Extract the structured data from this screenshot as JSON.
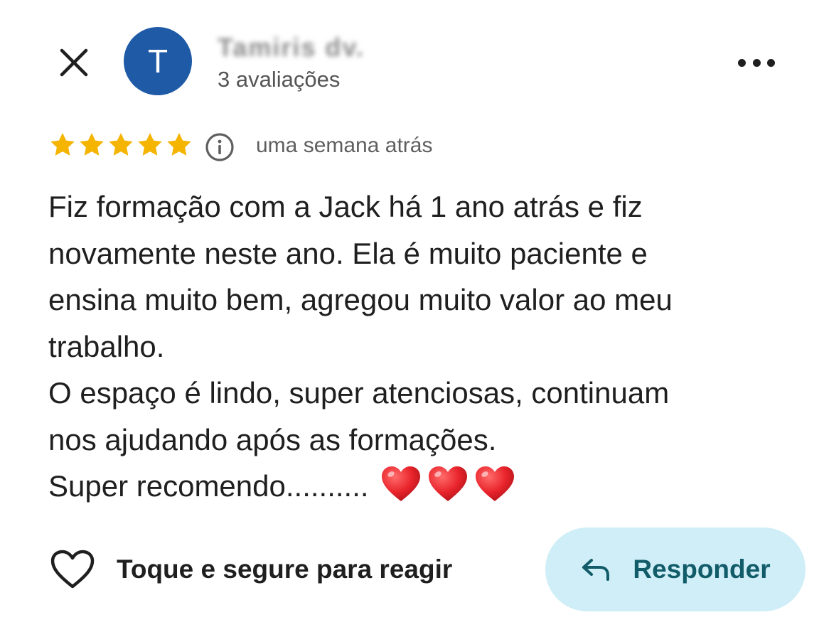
{
  "header": {
    "avatar_initial": "T",
    "reviewer_name": "Tamiris dv.",
    "review_count": "3 avaliações",
    "icons": {
      "close": "close-icon",
      "more": "more-options-icon"
    }
  },
  "rating": {
    "stars": 5,
    "max_stars": 5,
    "star_color": "#f4b400",
    "timestamp": "uma semana atrás",
    "info_icon": "info-icon"
  },
  "review": {
    "lines": [
      "Fiz formação com a Jack há 1 ano atrás e fiz",
      "novamente neste ano. Ela é muito paciente e",
      "ensina muito bem, agregou muito valor ao meu",
      "trabalho.",
      "O espaço é lindo, super atenciosas, continuam",
      "nos ajudando após as formações.",
      "Super recomendo.........."
    ],
    "emoji": [
      "heart-emoji",
      "heart-emoji",
      "heart-emoji"
    ]
  },
  "footer": {
    "react_label": "Toque e segure para reagir",
    "reply_label": "Responder",
    "reply_bg": "#cfeef7",
    "reply_text_color": "#125c6a",
    "icons": {
      "react": "heart-outline-icon",
      "reply": "reply-arrow-icon"
    }
  },
  "colors": {
    "avatar_bg": "#1f5aa6",
    "heart": "#e8232a"
  }
}
